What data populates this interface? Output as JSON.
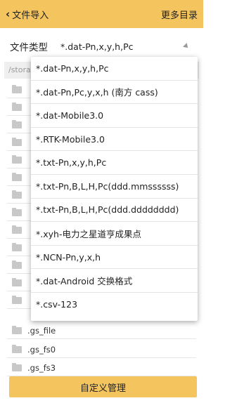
{
  "header": {
    "back_label": "文件导入",
    "more_label": "更多目录"
  },
  "file_type": {
    "label": "文件类型",
    "selected": "*.dat-Pn,x,y,h,Pc"
  },
  "path": {
    "value": "/stora"
  },
  "files": [
    {
      "name": ""
    },
    {
      "name": ""
    },
    {
      "name": ""
    },
    {
      "name": ""
    },
    {
      "name": ""
    },
    {
      "name": ""
    },
    {
      "name": ""
    },
    {
      "name": ""
    },
    {
      "name": ""
    },
    {
      "name": ""
    },
    {
      "name": ""
    },
    {
      "name": ""
    },
    {
      "name": ""
    },
    {
      "name": ".gs_file"
    },
    {
      "name": ".gs_fs0"
    },
    {
      "name": ".gs_fs3"
    }
  ],
  "dropdown": {
    "options": [
      "*.dat-Pn,x,y,h,Pc",
      "*.dat-Pn,Pc,y,x,h (南方 cass)",
      "*.dat-Mobile3.0",
      "*.RTK-Mobile3.0",
      "*.txt-Pn,x,y,h,Pc",
      "*.txt-Pn,B,L,H,Pc(ddd.mmssssss)",
      "*.txt-Pn,B,L,H,Pc(ddd.dddddddd)",
      "*.xyh-电力之星道亨成果点",
      "*.NCN-Pn,y,x,h",
      "*.dat-Android 交换格式",
      "*.csv-123"
    ]
  },
  "bottom": {
    "button_label": "自定义管理"
  },
  "colors": {
    "accent": "#f4c55f"
  }
}
